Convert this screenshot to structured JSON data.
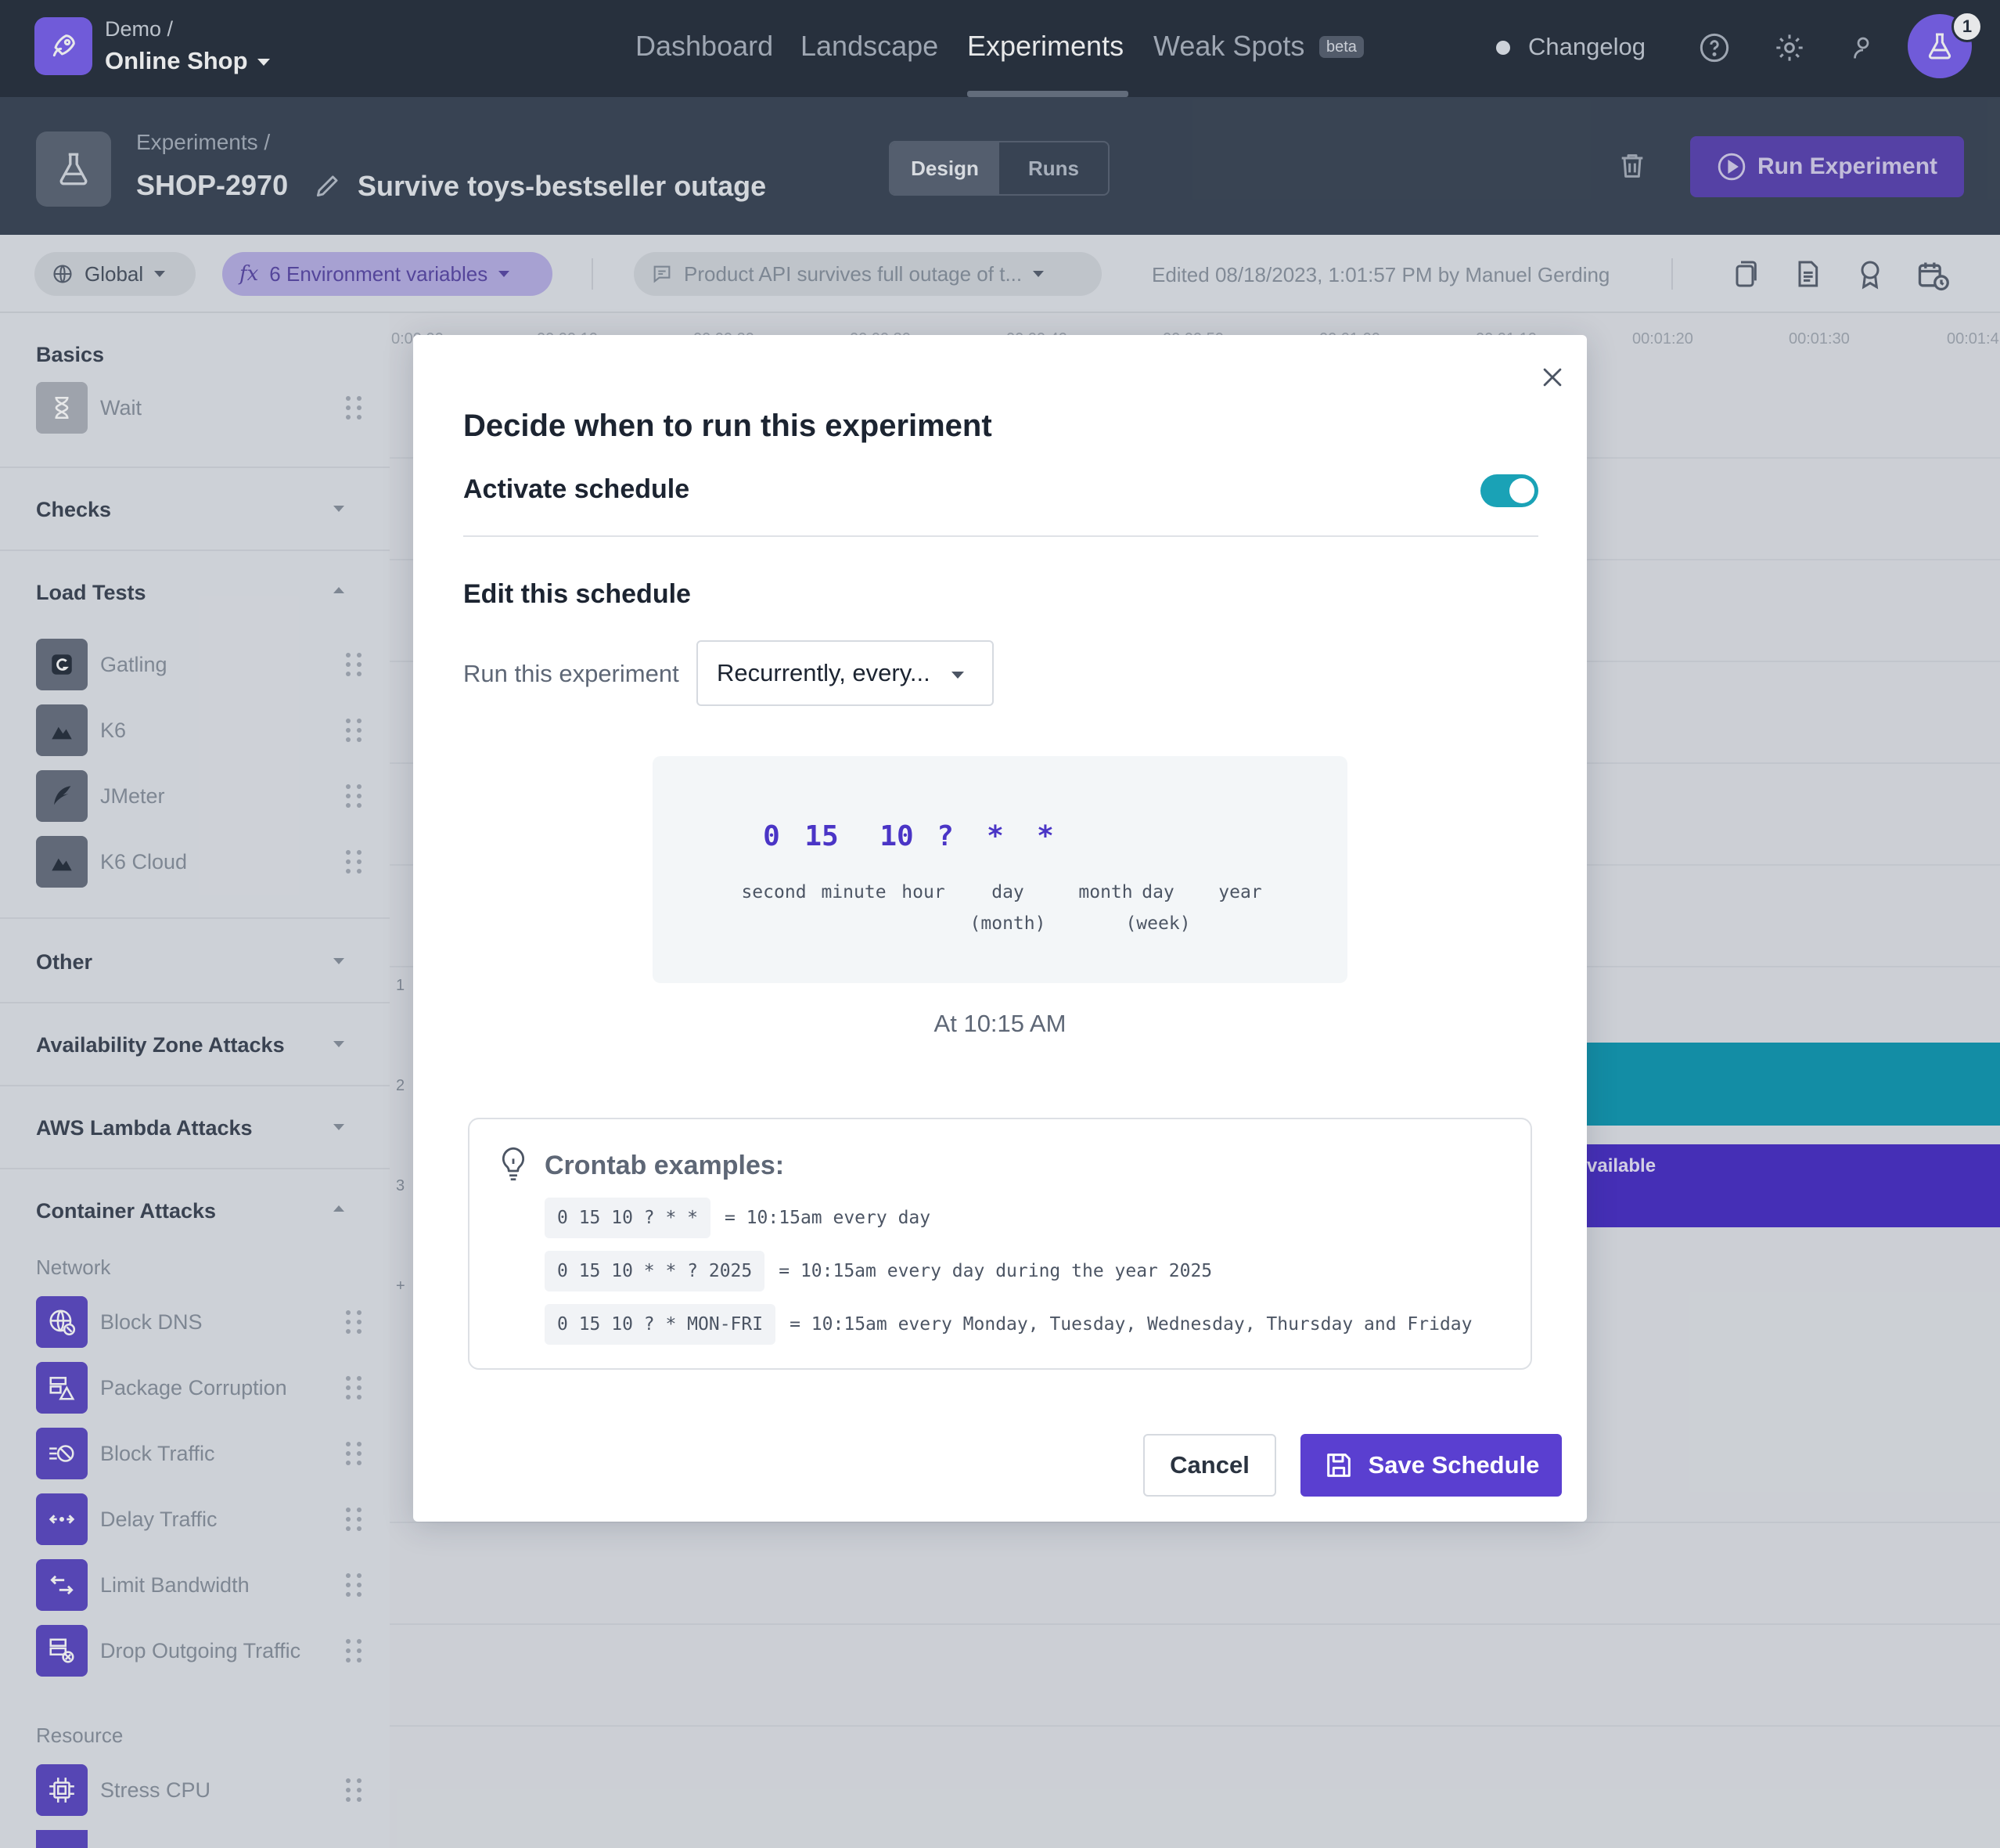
{
  "nav": {
    "org_sub": "Demo /",
    "org_name": "Online Shop",
    "items": [
      "Dashboard",
      "Landscape",
      "Experiments",
      "Weak Spots"
    ],
    "active": "Experiments",
    "beta": "beta",
    "changelog": "Changelog",
    "notification_count": "1"
  },
  "header": {
    "breadcrumb": "Experiments /",
    "key": "SHOP-2970",
    "title": "Survive toys-bestseller outage",
    "tabs": [
      "Design",
      "Runs"
    ],
    "run_button": "Run Experiment"
  },
  "toolbar": {
    "environment": "Global",
    "env_vars": "6 Environment variables",
    "fx": "fx",
    "hypothesis": "Product API survives full outage of t...",
    "edited": "Edited 08/18/2023, 1:01:57 PM by Manuel Gerding"
  },
  "sidebar": {
    "basics": "Basics",
    "wait": "Wait",
    "checks": "Checks",
    "load_tests": "Load Tests",
    "load_items": [
      "Gatling",
      "K6",
      "JMeter",
      "K6 Cloud"
    ],
    "other": "Other",
    "az_attacks": "Availability Zone Attacks",
    "lambda_attacks": "AWS Lambda Attacks",
    "container_attacks": "Container Attacks",
    "network": "Network",
    "network_items": [
      "Block DNS",
      "Package Corruption",
      "Block Traffic",
      "Delay Traffic",
      "Limit Bandwidth",
      "Drop Outgoing Traffic"
    ],
    "resource": "Resource",
    "resource_items": [
      "Stress CPU"
    ]
  },
  "timeline": {
    "ticks": [
      "0:00:00",
      "00:00:10",
      "00:00:20",
      "00:00:30",
      "00:00:40",
      "00:00:50",
      "00:01:00",
      "00:01:10",
      "00:01:20",
      "00:01:30",
      "00:01:4"
    ],
    "lanes": [
      "1",
      "2",
      "3",
      "+"
    ],
    "purple_bar_label": "vailable"
  },
  "modal": {
    "title": "Decide when to run this experiment",
    "activate_label": "Activate schedule",
    "activate_on": true,
    "edit_label": "Edit this schedule",
    "run_label": "Run this experiment",
    "run_select": "Recurrently, every...",
    "cron": {
      "values": [
        "0",
        "15",
        "10",
        "?",
        "*",
        "*"
      ],
      "labels": [
        "second",
        "minute",
        "hour",
        "day\n(month)",
        "month",
        "day\n(week)",
        "year"
      ]
    },
    "human_readable": "At 10:15 AM",
    "examples_title": "Crontab examples:",
    "examples": [
      {
        "code": "0 15 10 ? * *",
        "desc": "= 10:15am every day"
      },
      {
        "code": "0 15 10 * * ? 2025",
        "desc": "= 10:15am every day during the year 2025"
      },
      {
        "code": "0 15 10 ? * MON-FRI",
        "desc": "= 10:15am every Monday, Tuesday, Wednesday, Thursday and Friday"
      }
    ],
    "cancel": "Cancel",
    "save": "Save Schedule"
  },
  "colors": {
    "accent": "#5a3fd0",
    "toggle": "#1aa2b6",
    "nav_bg": "#2a3340"
  }
}
